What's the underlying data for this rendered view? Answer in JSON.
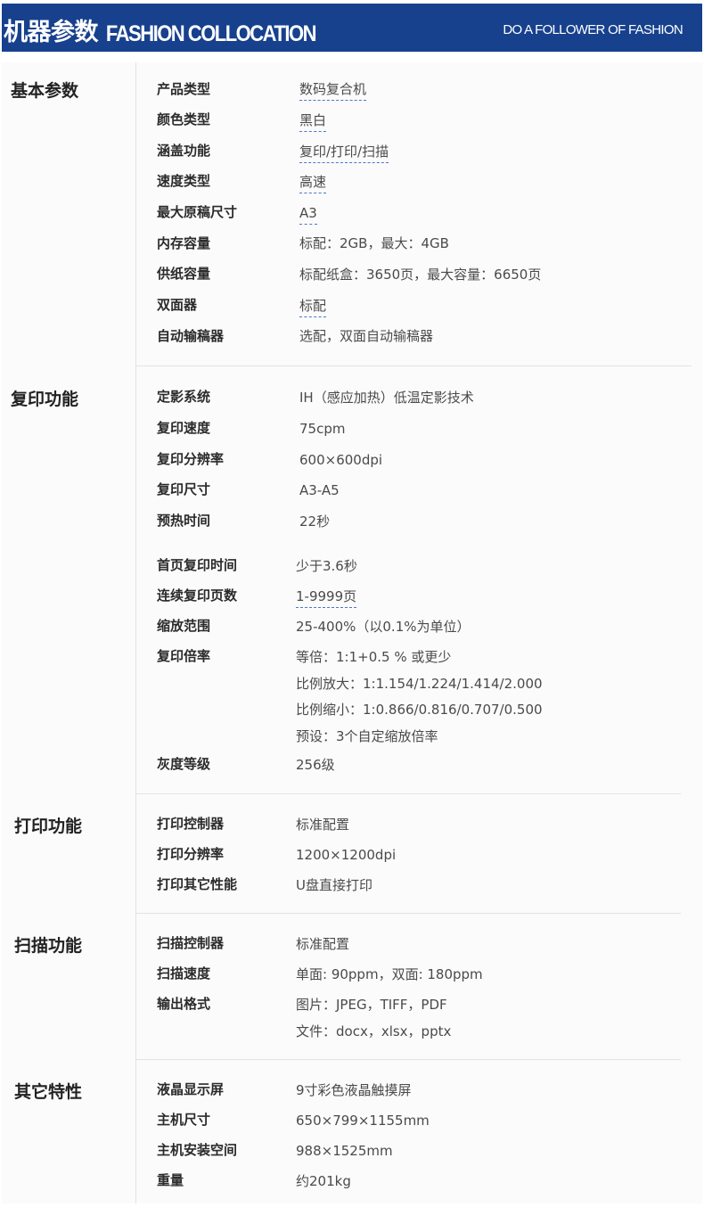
{
  "header": {
    "title_cn": "机器参数",
    "title_en": "FASHION COLLOCATION",
    "slogan": "DO A FOLLOWER OF FASHION"
  },
  "sections": [
    {
      "title": "基本参数",
      "rows": [
        {
          "label": "产品类型",
          "values": [
            "数码复合机"
          ]
        },
        {
          "label": "颜色类型",
          "values": [
            "黑白"
          ]
        },
        {
          "label": "涵盖功能",
          "values": [
            "复印/打印/扫描"
          ]
        },
        {
          "label": "速度类型",
          "values": [
            "高速"
          ]
        },
        {
          "label": "最大原稿尺寸",
          "values": [
            "A3"
          ]
        },
        {
          "label": "内存容量",
          "values": [
            "标配：2GB，最大：4GB"
          ]
        },
        {
          "label": "供纸容量",
          "values": [
            "标配纸盒：3650页，最大容量：6650页"
          ]
        },
        {
          "label": "双面器",
          "values": [
            "标配"
          ]
        },
        {
          "label": "自动输稿器",
          "values": [
            "选配，双面自动输稿器"
          ]
        }
      ]
    },
    {
      "title": "复印功能",
      "rows": [
        {
          "label": "定影系统",
          "values": [
            "IH（感应加热）低温定影技术"
          ]
        },
        {
          "label": "复印速度",
          "values": [
            "75cpm"
          ]
        },
        {
          "label": "复印分辨率",
          "values": [
            "600×600dpi"
          ]
        },
        {
          "label": "复印尺寸",
          "values": [
            "A3-A5"
          ]
        },
        {
          "label": "预热时间",
          "values": [
            "22秒"
          ]
        },
        {
          "label": "首页复印时间",
          "values": [
            "少于3.6秒"
          ]
        },
        {
          "label": "连续复印页数",
          "values": [
            "1-9999页"
          ]
        },
        {
          "label": "缩放范围",
          "values": [
            "25-400%（以0.1%为单位）"
          ]
        },
        {
          "label": "复印倍率",
          "values": [
            "等倍：1:1+0.5 % 或更少",
            "比例放大：1:1.154/1.224/1.414/2.000",
            "比例缩小：1:0.866/0.816/0.707/0.500",
            "预设：3个自定缩放倍率"
          ]
        },
        {
          "label": "灰度等级",
          "values": [
            "256级"
          ]
        }
      ]
    },
    {
      "title": "打印功能",
      "rows": [
        {
          "label": "打印控制器",
          "values": [
            "标准配置"
          ]
        },
        {
          "label": "打印分辨率",
          "values": [
            "1200×1200dpi"
          ]
        },
        {
          "label": "打印其它性能",
          "values": [
            "U盘直接打印"
          ]
        }
      ]
    },
    {
      "title": "扫描功能",
      "rows": [
        {
          "label": "扫描控制器",
          "values": [
            "标准配置"
          ]
        },
        {
          "label": "扫描速度",
          "values": [
            "单面: 90ppm，双面: 180ppm"
          ]
        },
        {
          "label": "输出格式",
          "values": [
            "图片：JPEG，TIFF，PDF",
            "文件：docx，xlsx，pptx"
          ]
        }
      ]
    },
    {
      "title": "其它特性",
      "rows": [
        {
          "label": "液晶显示屏",
          "values": [
            "9寸彩色液晶触摸屏"
          ]
        },
        {
          "label": "主机尺寸",
          "values": [
            "650×799×1155mm"
          ]
        },
        {
          "label": "主机安装空间",
          "values": [
            "988×1525mm"
          ]
        },
        {
          "label": "重量",
          "values": [
            "约201kg"
          ]
        }
      ]
    }
  ]
}
